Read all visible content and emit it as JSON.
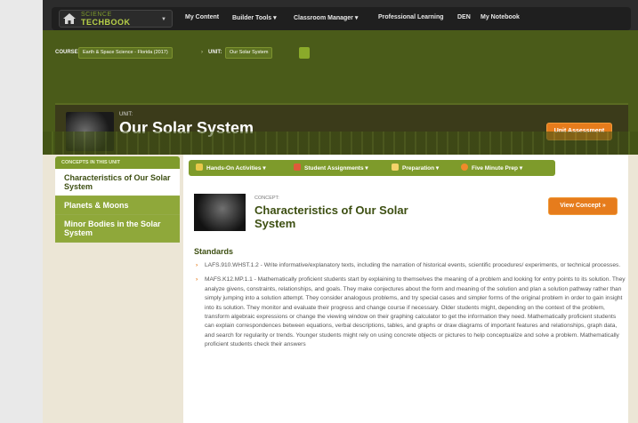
{
  "nav": {
    "logo_line1": "SCIENCE",
    "logo_line2": "TECHBOOK",
    "items": [
      "My Content",
      "Builder Tools ▾",
      "Classroom Manager ▾",
      "Professional Learning",
      "DEN",
      "My Notebook"
    ]
  },
  "breadcrumb": {
    "course_label": "COURSE:",
    "course_value": "Earth & Space Science - Florida (2017)",
    "unit_label": "UNIT:",
    "unit_value": "Our Solar System"
  },
  "unit": {
    "label": "UNIT:",
    "title": "Our Solar System",
    "assessment_button": "Unit Assessment"
  },
  "sidebar": {
    "heading": "CONCEPTS IN THIS UNIT",
    "items": [
      {
        "label": "Characteristics of Our Solar System",
        "active": true
      },
      {
        "label": "Planets & Moons",
        "active": false
      },
      {
        "label": "Minor Bodies in the Solar System",
        "active": false
      }
    ]
  },
  "toolbar": {
    "items": [
      {
        "label": "Hands-On Activities ▾",
        "icon": "flask-icon",
        "color": "#e8c84a"
      },
      {
        "label": "Student Assignments ▾",
        "icon": "assignment-icon",
        "color": "#e05a3a"
      },
      {
        "label": "Preparation ▾",
        "icon": "notepad-icon",
        "color": "#f4d36a"
      },
      {
        "label": "Five Minute Prep ▾",
        "icon": "clock-icon",
        "color": "#f08a2a"
      }
    ]
  },
  "concept": {
    "label": "CONCEPT:",
    "title": "Characteristics of Our Solar System",
    "view_button": "View Concept »"
  },
  "standards": {
    "title": "Standards",
    "items": [
      "LAFS.910.WHST.1.2 - Write informative/explanatory texts, including the narration of historical events, scientific procedures/ experiments, or technical processes.",
      "MAFS.K12.MP.1.1 - Mathematically proficient students start by explaining to themselves the meaning of a problem and looking for entry points to its solution. They analyze givens, constraints, relationships, and goals. They make conjectures about the form and meaning of the solution and plan a solution pathway rather than simply jumping into a solution attempt. They consider analogous problems, and try special cases and simpler forms of the original problem in order to gain insight into its solution. They monitor and evaluate their progress and change course if necessary. Older students might, depending on the context of the problem, transform algebraic expressions or change the viewing window on their graphing calculator to get the information they need. Mathematically proficient students can explain correspondences between equations, verbal descriptions, tables, and graphs or draw diagrams of important features and relationships, graph data, and search for regularity or trends. Younger students might rely on using concrete objects or pictures to help conceptualize and solve a problem. Mathematically proficient students check their answers"
    ]
  },
  "colors": {
    "accent_orange": "#e67c1c",
    "brand_green": "#7e9b2b",
    "header_band": "#4a5b19"
  }
}
